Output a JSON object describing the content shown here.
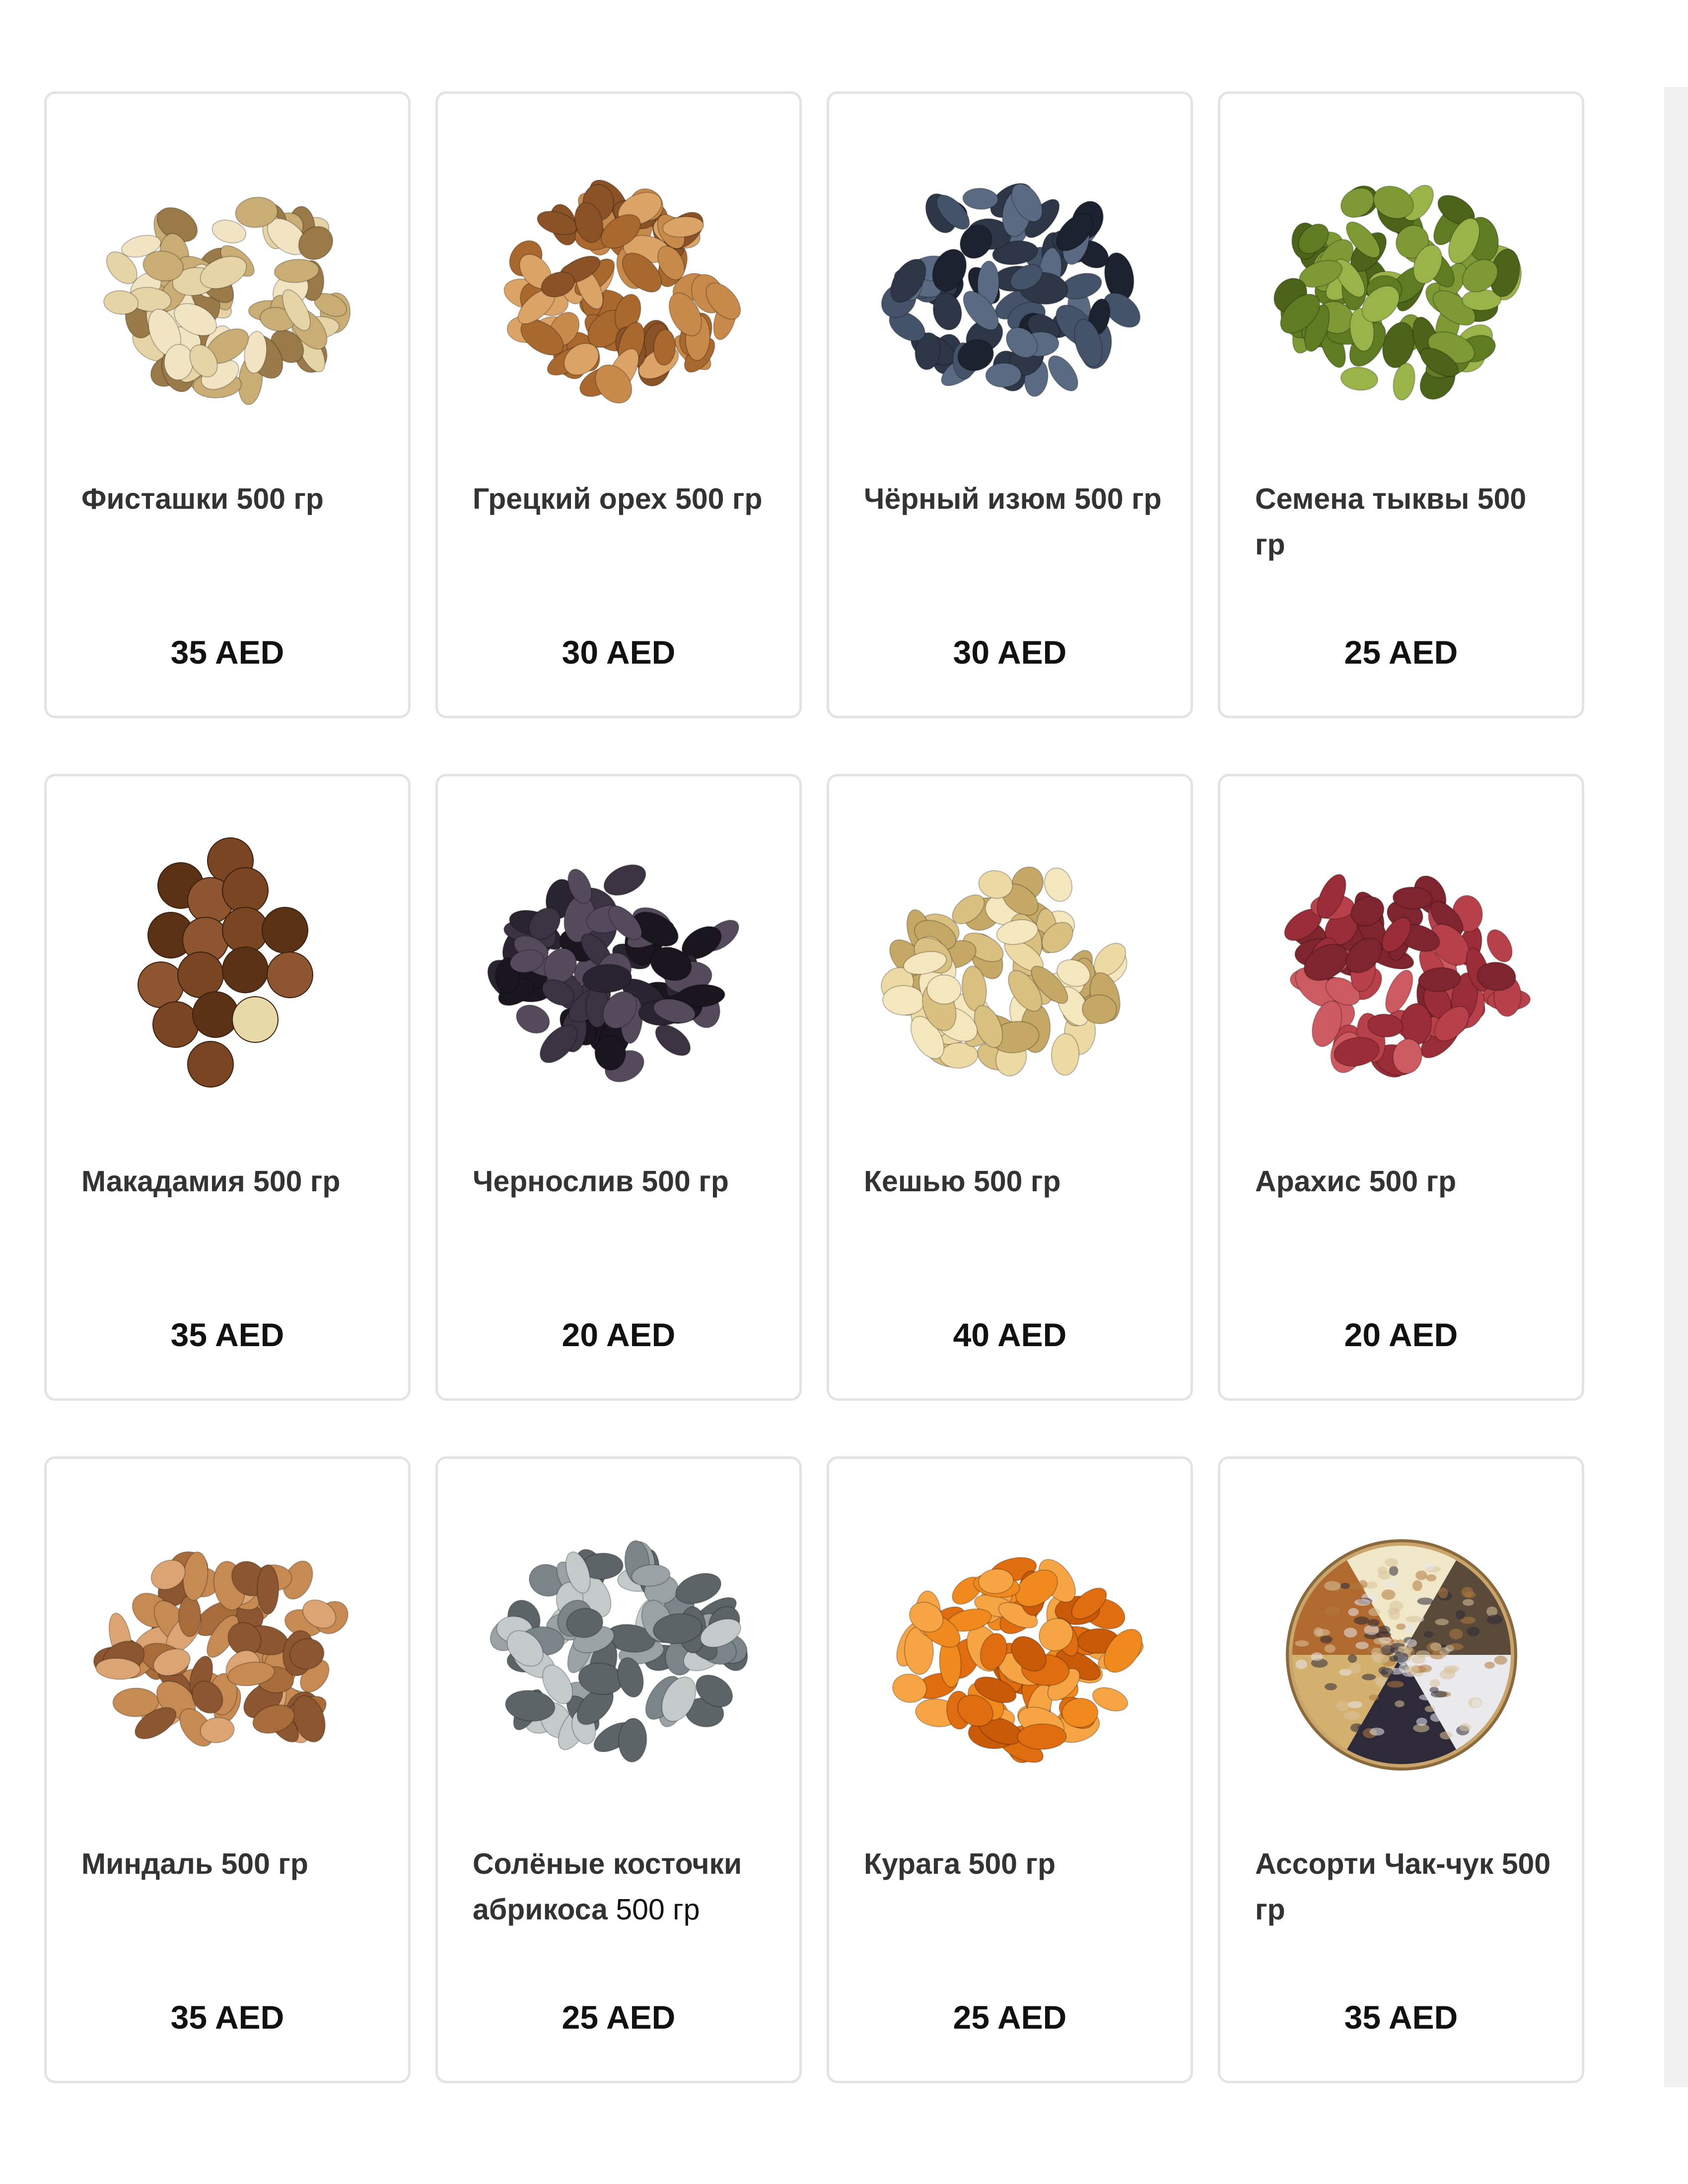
{
  "products": [
    {
      "title": "Фисташки 500 гр",
      "price": "35 AED",
      "image": "pistachios-image",
      "colors": [
        "#e6d3a6",
        "#c9ad74",
        "#f1e4c3",
        "#9a7a48"
      ]
    },
    {
      "title": "Грецкий орех 500 гр",
      "price": "30 AED",
      "image": "walnuts-image",
      "colors": [
        "#c88a4a",
        "#a8682e",
        "#dca367",
        "#8a5226"
      ]
    },
    {
      "title": "Чёрный изюм 500 гр",
      "price": "30 AED",
      "image": "black-raisins-image",
      "colors": [
        "#2e3748",
        "#45536a",
        "#1c2230",
        "#5a6a82"
      ]
    },
    {
      "title": "Семена тыквы 500 гр",
      "price": "25 AED",
      "image": "pumpkin-seeds-image",
      "colors": [
        "#7d9a35",
        "#5f7c22",
        "#9ab449",
        "#4c6419"
      ]
    },
    {
      "title": "Макадамия 500 гр",
      "price": "35 AED",
      "image": "macadamia-image",
      "colors": [
        "#7a4522",
        "#5c3216",
        "#8e5630",
        "#e8d9a8"
      ]
    },
    {
      "title": "Чернослив 500 гр",
      "price": "20 AED",
      "image": "prunes-image",
      "colors": [
        "#2a2330",
        "#3b3242",
        "#1a151f",
        "#544a5c"
      ]
    },
    {
      "title": "Кешью 500 гр",
      "price": "40 AED",
      "image": "cashews-image",
      "colors": [
        "#ecd9a4",
        "#d9bf80",
        "#f4e6bd",
        "#c6a866"
      ]
    },
    {
      "title": "Арахис 500 гр",
      "price": "20 AED",
      "image": "peanuts-image",
      "colors": [
        "#b8404a",
        "#9a2d38",
        "#cc5a60",
        "#7f2530"
      ]
    },
    {
      "title": "Миндаль 500 гр",
      "price": "35 AED",
      "image": "almonds-image",
      "colors": [
        "#c68a52",
        "#a86c3a",
        "#dba472",
        "#8c5630"
      ]
    },
    {
      "title": "Солёные косточки абрикоса",
      "title_suffix": "500 гр",
      "price": "25 AED",
      "image": "salted-apricot-kernels-image",
      "colors": [
        "#9aa2a6",
        "#7b8488",
        "#c4cacc",
        "#5c6468"
      ]
    },
    {
      "title": "Курага 500 гр",
      "price": "25 AED",
      "image": "dried-apricots-image",
      "colors": [
        "#f08a1e",
        "#e06d10",
        "#f7a544",
        "#c85a08"
      ]
    },
    {
      "title": "Ассорти Чак-чук 500 гр",
      "price": "35 AED",
      "image": "chak-chuk-assorted-image",
      "colors": [
        "#d8c39a",
        "#2e2a3a",
        "#e8e8ec",
        "#b07a3e"
      ]
    }
  ]
}
